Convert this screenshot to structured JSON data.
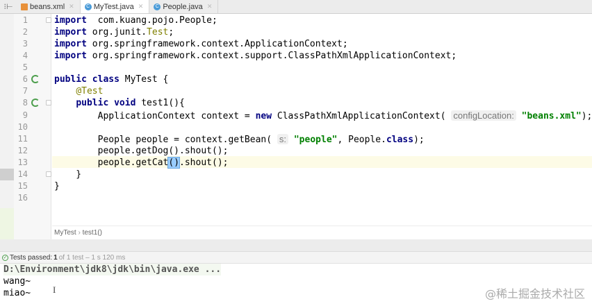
{
  "tabs": [
    {
      "label": "beans.xml",
      "icon": "xml-file-icon"
    },
    {
      "label": "MyTest.java",
      "icon": "class-icon",
      "active": true
    },
    {
      "label": "People.java",
      "icon": "class-icon"
    }
  ],
  "code": [
    [
      [
        "k",
        "import"
      ],
      [
        "",
        "  com.kuang.pojo.People;"
      ]
    ],
    [
      [
        "k",
        "import"
      ],
      [
        "",
        " org.junit."
      ],
      [
        "a",
        "Test"
      ],
      [
        "",
        ";"
      ]
    ],
    [
      [
        "k",
        "import"
      ],
      [
        "",
        " org.springframework.context.ApplicationContext;"
      ]
    ],
    [
      [
        "k",
        "import"
      ],
      [
        "",
        " org.springframework.context.support.ClassPathXmlApplicationContext;"
      ]
    ],
    [],
    [
      [
        "k",
        "public class"
      ],
      [
        "",
        " MyTest {"
      ]
    ],
    [
      [
        "",
        "    "
      ],
      [
        "a",
        "@Test"
      ]
    ],
    [
      [
        "",
        "    "
      ],
      [
        "k",
        "public void"
      ],
      [
        "",
        " test1(){"
      ]
    ],
    [
      [
        "",
        "        ApplicationContext context = "
      ],
      [
        "k",
        "new"
      ],
      [
        "",
        " ClassPathXmlApplicationContext( "
      ],
      [
        "h",
        "configLocation:"
      ],
      [
        "",
        " "
      ],
      [
        "s",
        "\"beans.xml\""
      ],
      [
        "",
        ");"
      ]
    ],
    [],
    [
      [
        "",
        "        People people = context.getBean( "
      ],
      [
        "h",
        "s:"
      ],
      [
        "",
        " "
      ],
      [
        "s",
        "\"people\""
      ],
      [
        "",
        ", People."
      ],
      [
        "k",
        "class"
      ],
      [
        "",
        ");"
      ]
    ],
    [
      [
        "",
        "        people.getDog().shout();"
      ]
    ],
    [
      [
        "",
        "        people.getCat"
      ],
      [
        "br",
        "()"
      ],
      [
        "",
        ".shout();"
      ]
    ],
    [
      [
        "",
        "    }"
      ]
    ],
    [
      [
        "",
        "}"
      ]
    ],
    []
  ],
  "breadcrumb": {
    "class": "MyTest",
    "method": "test1()"
  },
  "status": {
    "label": "Tests passed:",
    "count": "1",
    "detail": "of 1 test – 1 s 120 ms"
  },
  "console": [
    "D:\\Environment\\jdk8\\jdk\\bin\\java.exe ...",
    "wang~",
    "miao~"
  ],
  "watermark": "@稀土掘金技术社区"
}
